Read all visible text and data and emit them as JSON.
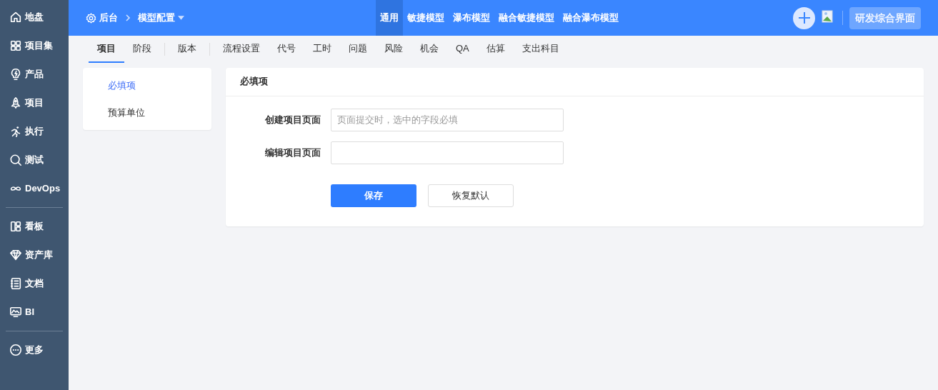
{
  "sidebar": {
    "sections": [
      [
        {
          "kind": "home",
          "label": "地盘"
        },
        {
          "kind": "grid",
          "label": "项目集"
        },
        {
          "kind": "bulb",
          "label": "产品"
        },
        {
          "kind": "rocket",
          "label": "项目"
        },
        {
          "kind": "run",
          "label": "执行"
        },
        {
          "kind": "search",
          "label": "测试"
        },
        {
          "kind": "infinity",
          "label": "DevOps"
        }
      ],
      [
        {
          "kind": "board",
          "label": "看板"
        },
        {
          "kind": "diamond",
          "label": "资产库"
        },
        {
          "kind": "doc",
          "label": "文档"
        },
        {
          "kind": "monitor",
          "label": "BI"
        }
      ],
      [
        {
          "kind": "more",
          "label": "更多"
        }
      ]
    ]
  },
  "header": {
    "breadcrumb": {
      "root": "后台",
      "current": "模型配置"
    },
    "model_tabs": [
      {
        "label": "通用",
        "selected": true
      },
      {
        "label": "敏捷模型",
        "selected": false
      },
      {
        "label": "瀑布模型",
        "selected": false
      },
      {
        "label": "融合敏捷模型",
        "selected": false
      },
      {
        "label": "融合瀑布模型",
        "selected": false
      }
    ],
    "switch_button": "研发综合界面"
  },
  "subtabs": [
    [
      {
        "label": "项目",
        "selected": true
      },
      {
        "label": "阶段",
        "selected": false
      }
    ],
    [
      {
        "label": "版本",
        "selected": false
      }
    ],
    [
      {
        "label": "流程设置",
        "selected": false
      },
      {
        "label": "代号",
        "selected": false
      },
      {
        "label": "工时",
        "selected": false
      },
      {
        "label": "问题",
        "selected": false
      },
      {
        "label": "风险",
        "selected": false
      },
      {
        "label": "机会",
        "selected": false
      },
      {
        "label": "QA",
        "selected": false
      },
      {
        "label": "估算",
        "selected": false
      },
      {
        "label": "支出科目",
        "selected": false
      }
    ]
  ],
  "side_menu": [
    {
      "label": "必填项",
      "selected": true
    },
    {
      "label": "预算单位",
      "selected": false
    }
  ],
  "panel": {
    "title": "必填项",
    "fields": [
      {
        "label": "创建项目页面",
        "placeholder": "页面提交时，选中的字段必填"
      },
      {
        "label": "编辑项目页面"
      }
    ],
    "buttons": [
      {
        "label": "保存",
        "kind": "primary"
      },
      {
        "label": "恢复默认",
        "kind": "secondary"
      }
    ]
  }
}
